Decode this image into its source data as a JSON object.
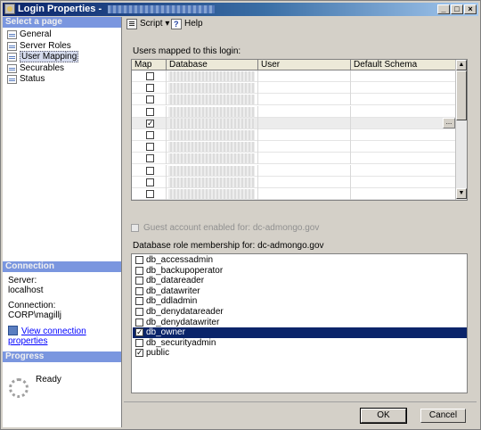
{
  "window": {
    "title": "Login Properties -",
    "minimize": "_",
    "maximize": "□",
    "close": "×"
  },
  "leftpane": {
    "select_page_header": "Select a page",
    "pages": [
      {
        "label": "General",
        "selected": false
      },
      {
        "label": "Server Roles",
        "selected": false
      },
      {
        "label": "User Mapping",
        "selected": true
      },
      {
        "label": "Securables",
        "selected": false
      },
      {
        "label": "Status",
        "selected": false
      }
    ],
    "connection_header": "Connection",
    "server_label": "Server:",
    "server_value": "localhost",
    "connection_label": "Connection:",
    "connection_value": "CORP\\magillj",
    "view_properties_link": "View connection properties",
    "progress_header": "Progress",
    "progress_status": "Ready"
  },
  "toolbar": {
    "script_label": "Script",
    "script_dropdown": "▾",
    "help_label": "Help"
  },
  "mapping": {
    "section_label": "Users mapped to this login:",
    "columns": [
      "Map",
      "Database",
      "User",
      "Default Schema"
    ],
    "rows": [
      {
        "mapped": false,
        "selected": false
      },
      {
        "mapped": false,
        "selected": false
      },
      {
        "mapped": false,
        "selected": false
      },
      {
        "mapped": false,
        "selected": false
      },
      {
        "mapped": true,
        "selected": true
      },
      {
        "mapped": false,
        "selected": false
      },
      {
        "mapped": false,
        "selected": false
      },
      {
        "mapped": false,
        "selected": false
      },
      {
        "mapped": false,
        "selected": false
      },
      {
        "mapped": false,
        "selected": false
      },
      {
        "mapped": false,
        "selected": false
      }
    ],
    "ellipsis": "...",
    "scroll_up": "▲",
    "scroll_down": "▼"
  },
  "guest_account": {
    "label": "Guest account enabled for: dc-admongo.gov",
    "checked": false,
    "enabled": false
  },
  "roles": {
    "section_label": "Database role membership for: dc-admongo.gov",
    "items": [
      {
        "name": "db_accessadmin",
        "checked": false,
        "highlighted": false
      },
      {
        "name": "db_backupoperator",
        "checked": false,
        "highlighted": false
      },
      {
        "name": "db_datareader",
        "checked": false,
        "highlighted": false
      },
      {
        "name": "db_datawriter",
        "checked": false,
        "highlighted": false
      },
      {
        "name": "db_ddladmin",
        "checked": false,
        "highlighted": false
      },
      {
        "name": "db_denydatareader",
        "checked": false,
        "highlighted": false
      },
      {
        "name": "db_denydatawriter",
        "checked": false,
        "highlighted": false
      },
      {
        "name": "db_owner",
        "checked": true,
        "highlighted": true
      },
      {
        "name": "db_securityadmin",
        "checked": false,
        "highlighted": false
      },
      {
        "name": "public",
        "checked": true,
        "highlighted": false
      }
    ]
  },
  "buttons": {
    "ok": "OK",
    "cancel": "Cancel"
  },
  "check_glyph": "✓"
}
